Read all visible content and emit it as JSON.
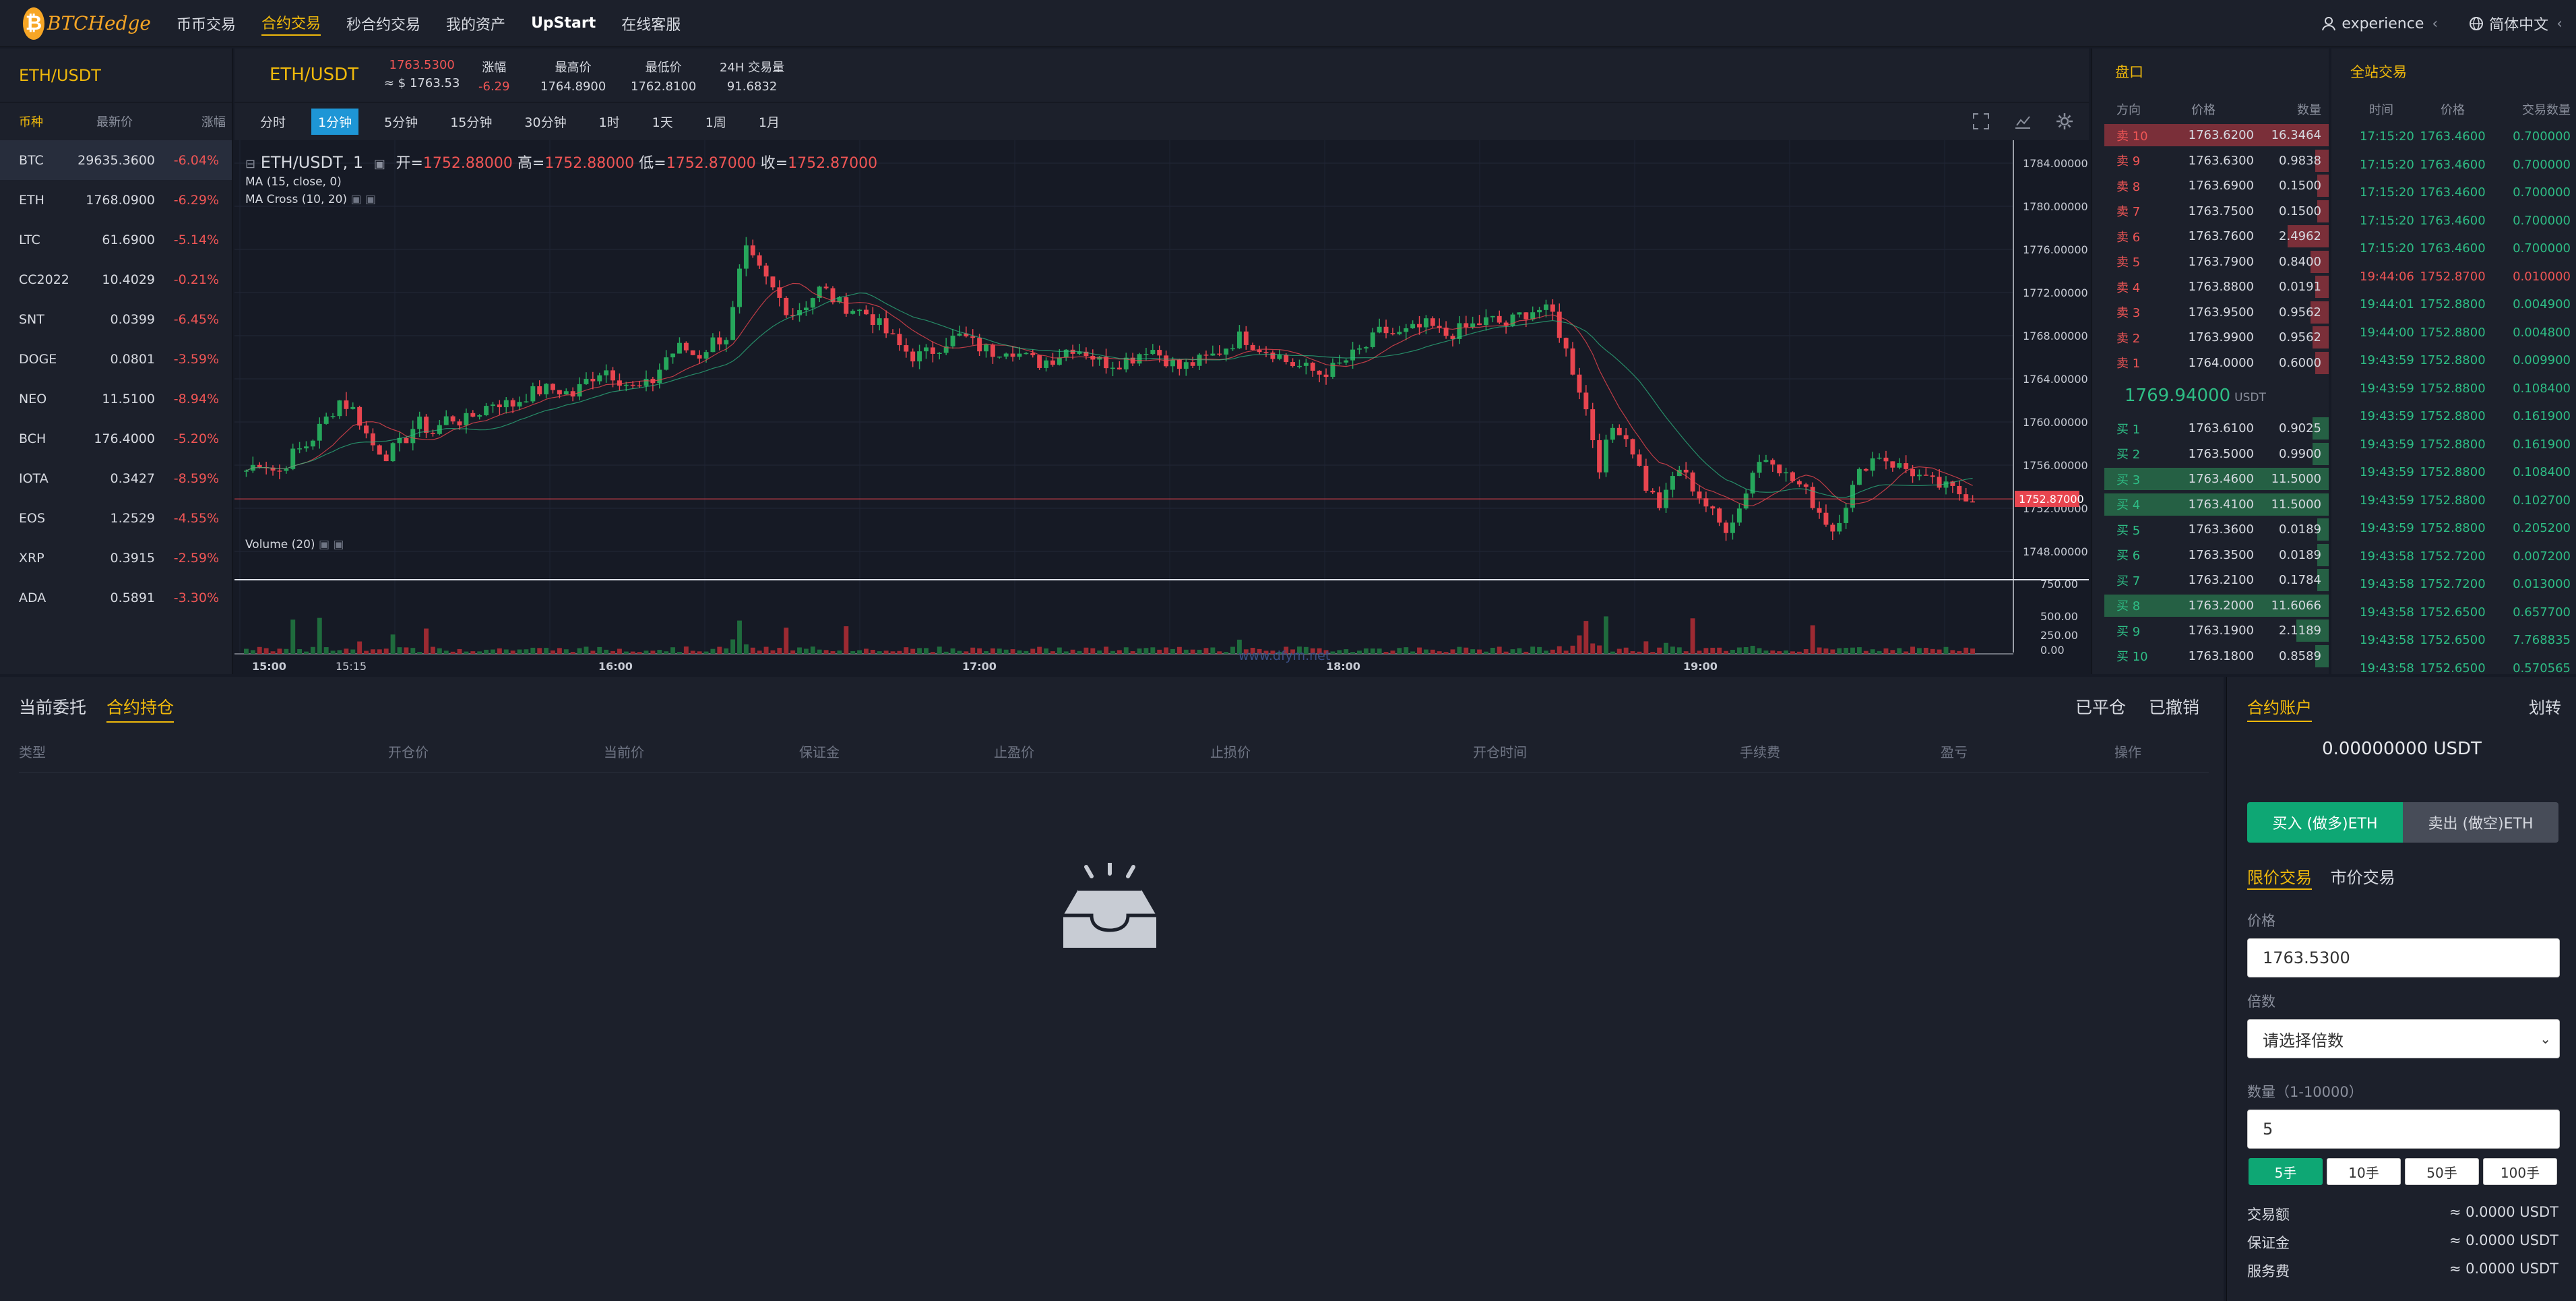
{
  "nav": {
    "logo_text": "BTCHedge",
    "items": [
      "币币交易",
      "合约交易",
      "秒合约交易",
      "我的资产",
      "UpStart",
      "在线客服"
    ],
    "active_index": 1,
    "user": "experience",
    "language": "简体中文"
  },
  "market": {
    "pair_title": "ETH/USDT",
    "headers": [
      "币种",
      "最新价",
      "涨幅"
    ],
    "rows": [
      {
        "sym": "BTC",
        "price": "29635.3600",
        "chg": "-6.04%"
      },
      {
        "sym": "ETH",
        "price": "1768.0900",
        "chg": "-6.29%"
      },
      {
        "sym": "LTC",
        "price": "61.6900",
        "chg": "-5.14%"
      },
      {
        "sym": "CC2022",
        "price": "10.4029",
        "chg": "-0.21%"
      },
      {
        "sym": "SNT",
        "price": "0.0399",
        "chg": "-6.45%"
      },
      {
        "sym": "DOGE",
        "price": "0.0801",
        "chg": "-3.59%"
      },
      {
        "sym": "NEO",
        "price": "11.5100",
        "chg": "-8.94%"
      },
      {
        "sym": "BCH",
        "price": "176.4000",
        "chg": "-5.20%"
      },
      {
        "sym": "IOTA",
        "price": "0.3427",
        "chg": "-8.59%"
      },
      {
        "sym": "EOS",
        "price": "1.2529",
        "chg": "-4.55%"
      },
      {
        "sym": "XRP",
        "price": "0.3915",
        "chg": "-2.59%"
      },
      {
        "sym": "ADA",
        "price": "0.5891",
        "chg": "-3.30%"
      }
    ]
  },
  "ticker": {
    "pair": "ETH/USDT",
    "last_price": "1763.5300",
    "last_usd": "≈ $ 1763.53",
    "chg_label": "涨幅",
    "chg_value": "-6.29",
    "high_label": "最高价",
    "high_value": "1764.8900",
    "low_label": "最低价",
    "low_value": "1762.8100",
    "vol_label": "24H 交易量",
    "vol_value": "91.6832"
  },
  "timeframes": [
    "分时",
    "1分钟",
    "5分钟",
    "15分钟",
    "30分钟",
    "1时",
    "1天",
    "1周",
    "1月"
  ],
  "active_timeframe": 1,
  "chart_legend": {
    "symbol": "ETH/USDT, 1",
    "open_label": "开=",
    "open": "1752.88000",
    "high_label": "高=",
    "high": "1752.88000",
    "low_label": "低=",
    "low": "1752.87000",
    "close_label": "收=",
    "close": "1752.87000",
    "ma": "MA (15, close, 0)",
    "ma_cross": "MA Cross (10, 20)",
    "volume": "Volume (20)",
    "watermark": "www.dfym.net"
  },
  "chart_data": {
    "type": "candlestick",
    "price_ticks": [
      "1784.00000",
      "1780.00000",
      "1776.00000",
      "1772.00000",
      "1768.00000",
      "1764.00000",
      "1760.00000",
      "1756.00000",
      "1752.00000",
      "1748.00000"
    ],
    "price_range": [
      1746.5,
      1785.5
    ],
    "current_price_label": "1752.87000",
    "volume_ticks": [
      "750.00",
      "500.00",
      "250.00",
      "0.00"
    ],
    "time_ticks": [
      "15:00",
      "15:15",
      "16:00",
      "17:00",
      "18:00",
      "19:00"
    ],
    "close_path": [
      1755.5,
      1756.5,
      1755.2,
      1757,
      1758,
      1760,
      1762,
      1761,
      1758,
      1757,
      1758,
      1760,
      1759,
      1760.5,
      1760,
      1761,
      1762,
      1761.5,
      1762.5,
      1763,
      1763,
      1762.5,
      1764,
      1765,
      1764,
      1763,
      1763.5,
      1766,
      1767,
      1766,
      1767.5,
      1768,
      1776,
      1774,
      1772,
      1770,
      1771,
      1772.5,
      1771,
      1770.5,
      1770,
      1768.5,
      1767,
      1766,
      1766.5,
      1767.5,
      1768,
      1767,
      1766.5,
      1767,
      1766,
      1765.5,
      1766,
      1767,
      1766.5,
      1765.5,
      1765.5,
      1766,
      1767,
      1766,
      1765,
      1765.5,
      1766,
      1767,
      1768,
      1767,
      1766.5,
      1765.5,
      1765,
      1764.5,
      1765,
      1766,
      1767,
      1768.5,
      1768,
      1768.5,
      1769,
      1768,
      1768.5,
      1769,
      1769.5,
      1769,
      1770,
      1770.5,
      1770,
      1766,
      1762,
      1756,
      1760,
      1758,
      1754,
      1752,
      1756,
      1754,
      1752,
      1750,
      1752,
      1756,
      1757,
      1755,
      1754,
      1752,
      1750,
      1753,
      1756,
      1757,
      1756,
      1755.5,
      1754.5,
      1754,
      1753.5,
      1753
    ]
  },
  "orderbook": {
    "title": "盘口",
    "headers": [
      "方向",
      "价格",
      "数量"
    ],
    "asks": [
      {
        "dir": "卖 10",
        "price": "1763.6200",
        "qty": "16.3464",
        "depth": 0.98
      },
      {
        "dir": "卖 9",
        "price": "1763.6300",
        "qty": "0.9838",
        "depth": 0.06
      },
      {
        "dir": "卖 8",
        "price": "1763.6900",
        "qty": "0.1500",
        "depth": 0.05
      },
      {
        "dir": "卖 7",
        "price": "1763.7500",
        "qty": "0.1500",
        "depth": 0.05
      },
      {
        "dir": "卖 6",
        "price": "1763.7600",
        "qty": "2.4962",
        "depth": 0.18
      },
      {
        "dir": "卖 5",
        "price": "1763.7900",
        "qty": "0.8400",
        "depth": 0.08
      },
      {
        "dir": "卖 4",
        "price": "1763.8800",
        "qty": "0.0191",
        "depth": 0.06
      },
      {
        "dir": "卖 3",
        "price": "1763.9500",
        "qty": "0.9562",
        "depth": 0.08
      },
      {
        "dir": "卖 2",
        "price": "1763.9900",
        "qty": "0.9562",
        "depth": 0.07
      },
      {
        "dir": "卖 1",
        "price": "1764.0000",
        "qty": "0.6000",
        "depth": 0.06
      }
    ],
    "mid_price": "1769.94000",
    "mid_unit": "USDT",
    "bids": [
      {
        "dir": "买 1",
        "price": "1763.6100",
        "qty": "0.9025",
        "depth": 0.07
      },
      {
        "dir": "买 2",
        "price": "1763.5000",
        "qty": "0.9900",
        "depth": 0.07
      },
      {
        "dir": "买 3",
        "price": "1763.4600",
        "qty": "11.5000",
        "depth": 0.98
      },
      {
        "dir": "买 4",
        "price": "1763.4100",
        "qty": "11.5000",
        "depth": 0.98
      },
      {
        "dir": "买 5",
        "price": "1763.3600",
        "qty": "0.0189",
        "depth": 0.05
      },
      {
        "dir": "买 6",
        "price": "1763.3500",
        "qty": "0.0189",
        "depth": 0.05
      },
      {
        "dir": "买 7",
        "price": "1763.2100",
        "qty": "0.1784",
        "depth": 0.05
      },
      {
        "dir": "买 8",
        "price": "1763.2000",
        "qty": "11.6066",
        "depth": 0.98
      },
      {
        "dir": "买 9",
        "price": "1763.1900",
        "qty": "2.1189",
        "depth": 0.14
      },
      {
        "dir": "买 10",
        "price": "1763.1800",
        "qty": "0.8589",
        "depth": 0.06
      }
    ]
  },
  "trades": {
    "title": "全站交易",
    "headers": [
      "时间",
      "价格",
      "交易数量"
    ],
    "rows": [
      {
        "time": "17:15:20",
        "price": "1763.4600",
        "qty": "0.700000",
        "side": "buy"
      },
      {
        "time": "17:15:20",
        "price": "1763.4600",
        "qty": "0.700000",
        "side": "buy"
      },
      {
        "time": "17:15:20",
        "price": "1763.4600",
        "qty": "0.700000",
        "side": "buy"
      },
      {
        "time": "17:15:20",
        "price": "1763.4600",
        "qty": "0.700000",
        "side": "buy"
      },
      {
        "time": "17:15:20",
        "price": "1763.4600",
        "qty": "0.700000",
        "side": "buy"
      },
      {
        "time": "19:44:06",
        "price": "1752.8700",
        "qty": "0.010000",
        "side": "sell"
      },
      {
        "time": "19:44:01",
        "price": "1752.8800",
        "qty": "0.004900",
        "side": "buy"
      },
      {
        "time": "19:44:00",
        "price": "1752.8800",
        "qty": "0.004800",
        "side": "buy"
      },
      {
        "time": "19:43:59",
        "price": "1752.8800",
        "qty": "0.009900",
        "side": "buy"
      },
      {
        "time": "19:43:59",
        "price": "1752.8800",
        "qty": "0.108400",
        "side": "buy"
      },
      {
        "time": "19:43:59",
        "price": "1752.8800",
        "qty": "0.161900",
        "side": "buy"
      },
      {
        "time": "19:43:59",
        "price": "1752.8800",
        "qty": "0.161900",
        "side": "buy"
      },
      {
        "time": "19:43:59",
        "price": "1752.8800",
        "qty": "0.108400",
        "side": "buy"
      },
      {
        "time": "19:43:59",
        "price": "1752.8800",
        "qty": "0.102700",
        "side": "buy"
      },
      {
        "time": "19:43:59",
        "price": "1752.8800",
        "qty": "0.205200",
        "side": "buy"
      },
      {
        "time": "19:43:58",
        "price": "1752.7200",
        "qty": "0.007200",
        "side": "buy"
      },
      {
        "time": "19:43:58",
        "price": "1752.7200",
        "qty": "0.013000",
        "side": "buy"
      },
      {
        "time": "19:43:58",
        "price": "1752.6500",
        "qty": "0.657700",
        "side": "buy"
      },
      {
        "time": "19:43:58",
        "price": "1752.6500",
        "qty": "7.768835",
        "side": "buy"
      },
      {
        "time": "19:43:58",
        "price": "1752.6500",
        "qty": "0.570565",
        "side": "buy"
      }
    ]
  },
  "positions": {
    "tabs": [
      "当前委托",
      "合约持仓"
    ],
    "active_tab": 1,
    "right_links": [
      "已平仓",
      "已撤销"
    ],
    "headers": [
      "类型",
      "开仓价",
      "当前价",
      "保证金",
      "止盈价",
      "止损价",
      "开仓时间",
      "手续费",
      "盈亏",
      "操作"
    ]
  },
  "order_form": {
    "title": "合约账户",
    "transfer": "划转",
    "balance": "0.00000000 USDT",
    "buy_label": "买入 (做多)ETH",
    "sell_label": "卖出 (做空)ETH",
    "types": [
      "限价交易",
      "市价交易"
    ],
    "price_label": "价格",
    "price_value": "1763.5300",
    "leverage_label": "倍数",
    "leverage_placeholder": "请选择倍数",
    "qty_label": "数量（1-10000）",
    "qty_value": "5",
    "lots": [
      "5手",
      "10手",
      "50手",
      "100手"
    ],
    "summary": [
      {
        "label": "交易额",
        "value": "≈ 0.0000 USDT"
      },
      {
        "label": "保证金",
        "value": "≈ 0.0000 USDT"
      },
      {
        "label": "服务费",
        "value": "≈ 0.0000 USDT"
      }
    ]
  }
}
